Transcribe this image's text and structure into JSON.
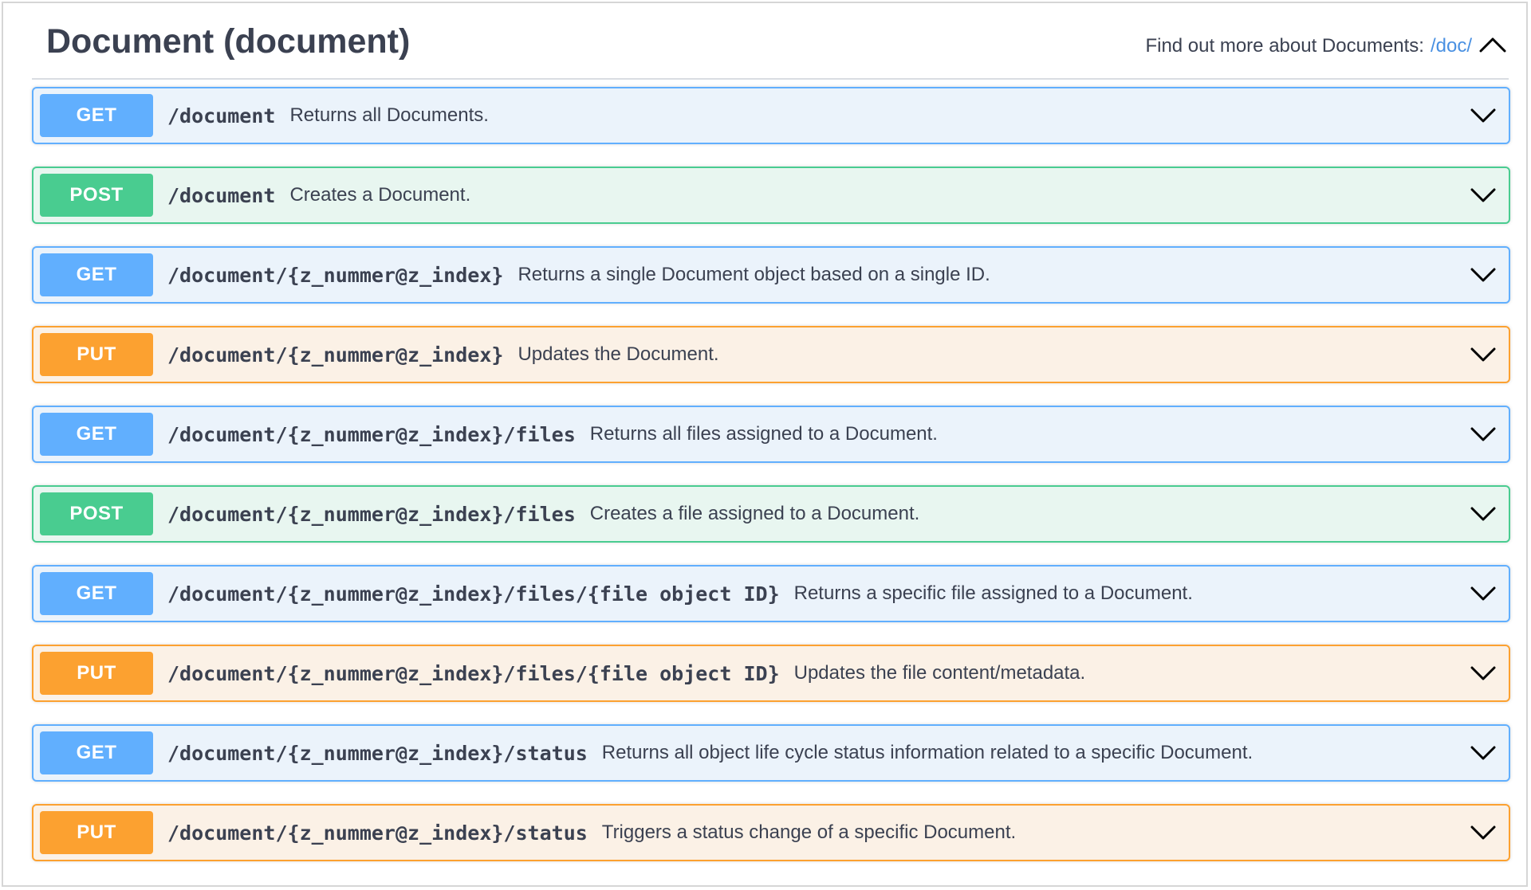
{
  "section": {
    "title": "Document (document)",
    "info_text": "Find out more about Documents:",
    "info_link": "/doc/",
    "collapse_icon": "chevron-up-icon"
  },
  "operations": [
    {
      "method": "GET",
      "path": "/document",
      "description": "Returns all Documents."
    },
    {
      "method": "POST",
      "path": "/document",
      "description": "Creates a Document."
    },
    {
      "method": "GET",
      "path": "/document/{z_nummer@z_index}",
      "description": "Returns a single Document object based on a single ID."
    },
    {
      "method": "PUT",
      "path": "/document/{z_nummer@z_index}",
      "description": "Updates the Document."
    },
    {
      "method": "GET",
      "path": "/document/{z_nummer@z_index}/files",
      "description": "Returns all files assigned to a Document."
    },
    {
      "method": "POST",
      "path": "/document/{z_nummer@z_index}/files",
      "description": "Creates a file assigned to a Document."
    },
    {
      "method": "GET",
      "path": "/document/{z_nummer@z_index}/files/{file object ID}",
      "description": "Returns a specific file assigned to a Document."
    },
    {
      "method": "PUT",
      "path": "/document/{z_nummer@z_index}/files/{file object ID}",
      "description": "Updates the file content/metadata."
    },
    {
      "method": "GET",
      "path": "/document/{z_nummer@z_index}/status",
      "description": "Returns all object life cycle status information related to a specific Document."
    },
    {
      "method": "PUT",
      "path": "/document/{z_nummer@z_index}/status",
      "description": "Triggers a status change of a specific Document."
    }
  ],
  "colors": {
    "get": "#61affe",
    "post": "#49cc90",
    "put": "#fca130",
    "link": "#4990e2",
    "text": "#3b4151"
  }
}
